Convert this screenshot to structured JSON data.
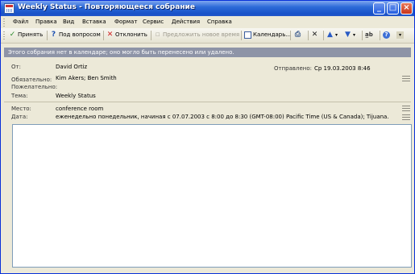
{
  "window": {
    "title": "Weekly Status - Повторяющееся собрание"
  },
  "menu": {
    "items": [
      "Файл",
      "Правка",
      "Вид",
      "Вставка",
      "Формат",
      "Сервис",
      "Действия",
      "Справка"
    ]
  },
  "toolbar": {
    "accept_label": "Принять",
    "tentative_label": "Под вопросом",
    "decline_label": "Отклонить",
    "propose_label": "Предложить новое время",
    "calendar_label": "Календарь..."
  },
  "info_bar": {
    "text": "Этого собрания нет в календаре; оно могло быть перенесено или удалено."
  },
  "header": {
    "from_label": "От:",
    "from_value": "David Ortiz",
    "sent_label": "Отправлено:",
    "sent_value": "Ср 19.03.2003 8:46",
    "required_label": "Обязательно:",
    "required_value": "Kim Akers; Ben Smith",
    "optional_label": "Пожелательно:",
    "subject_label": "Тема:",
    "subject_value": "Weekly Status"
  },
  "details": {
    "location_label": "Место:",
    "location_value": "conference room",
    "date_label": "Дата:",
    "date_value": "еженедельно понедельник, начиная с 07.07.2003 с 8:00 до 8:30 (GMT-08:00) Pacific Time (US & Canada); Tijuana."
  },
  "body": {
    "text": ""
  }
}
